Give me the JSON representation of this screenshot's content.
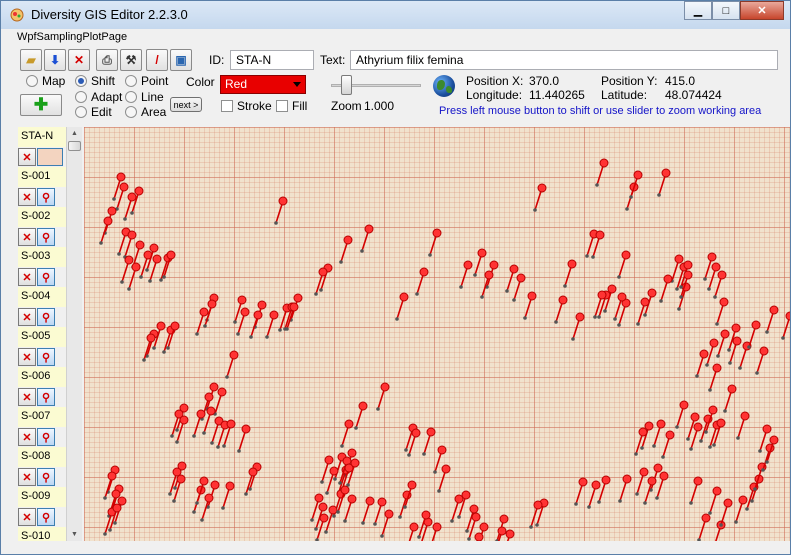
{
  "window": {
    "title": "Diversity GIS Editor 2.2.3.0"
  },
  "menu": {
    "tab": "WpfSamplingPlotPage"
  },
  "toolbar": {
    "id_label": "ID:",
    "id_value": "STA-N",
    "text_label": "Text:",
    "text_value": "Athyrium filix femina",
    "modes": {
      "map": "Map",
      "shift": "Shift",
      "adapt": "Adapt",
      "edit": "Edit",
      "point": "Point",
      "line": "Line",
      "area": "Area"
    },
    "next_label": "next >",
    "color_label": "Color",
    "color_value": "Red",
    "stroke_label": "Stroke",
    "fill_label": "Fill",
    "zoom_label": "Zoom",
    "zoom_value": "1.000",
    "pos_x_label": "Position X:",
    "pos_x_value": "370.0",
    "pos_y_label": "Position Y:",
    "pos_y_value": "415.0",
    "lon_label": "Longitude:",
    "lon_value": "11.440265",
    "lat_label": "Latitude:",
    "lat_value": "48.074424",
    "hint": "Press left mouse button to shift or use slider to zoom working area",
    "accent_color": "#e80000"
  },
  "plots": [
    "STA-N",
    "S-001",
    "S-002",
    "S-003",
    "S-004",
    "S-005",
    "S-006",
    "S-007",
    "S-008",
    "S-009",
    "S-010"
  ]
}
